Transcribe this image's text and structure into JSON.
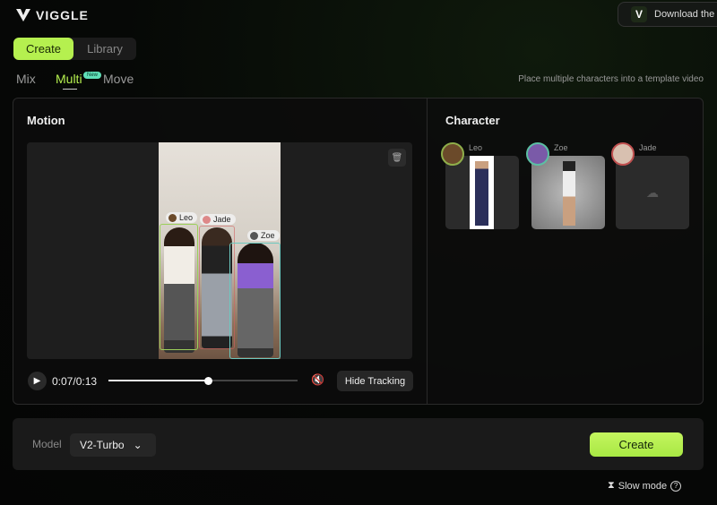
{
  "app": {
    "brand": "VIGGLE",
    "download_label": "Download the"
  },
  "nav": {
    "segments": [
      {
        "label": "Create",
        "active": true
      },
      {
        "label": "Library",
        "active": false
      }
    ],
    "modes": [
      {
        "label": "Mix"
      },
      {
        "label": "Multi",
        "active": true,
        "badge": "New"
      },
      {
        "label": "Move"
      }
    ],
    "subtitle": "Place multiple characters into a template video"
  },
  "motion": {
    "title": "Motion",
    "tracking_labels": [
      "Leo",
      "Jade",
      "Zoe"
    ],
    "time": "0:07/0:13",
    "progress": 0.53,
    "hide_tracking_label": "Hide Tracking"
  },
  "character": {
    "title": "Character",
    "items": [
      {
        "name": "Leo",
        "ring": "#8fae4a"
      },
      {
        "name": "Zoe",
        "ring": "#5bbfa3"
      },
      {
        "name": "Jade",
        "ring": "#c05050"
      }
    ]
  },
  "bottom": {
    "model_label": "Model",
    "model_value": "V2-Turbo",
    "create_label": "Create",
    "slow_mode_label": "Slow mode"
  },
  "colors": {
    "accent": "#b5f04f",
    "leo": "#9ccf5a",
    "jade": "#d06060",
    "zoe": "#6cc9c0"
  }
}
